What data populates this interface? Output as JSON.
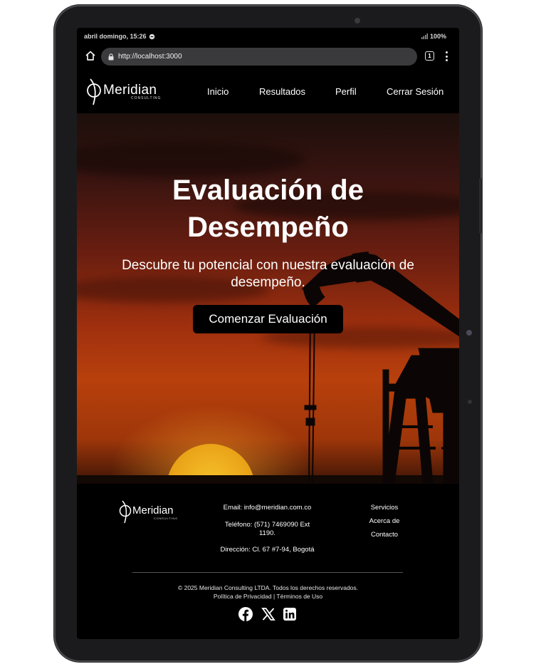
{
  "status_bar": {
    "time_text": "abril domingo, 15:26",
    "battery": "100%"
  },
  "browser": {
    "url": "http://localhost:3000",
    "tab_count": "1"
  },
  "nav": {
    "logo": "Meridian",
    "logo_sub": "CONSULTING",
    "links": [
      "Inicio",
      "Resultados",
      "Perfil",
      "Cerrar Sesión"
    ]
  },
  "hero": {
    "title_line1": "Evaluación de",
    "title_line2": "Desempeño",
    "subtitle": "Descubre tu potencial con nuestra evaluación de desempeño.",
    "cta": "Comenzar Evaluación"
  },
  "footer": {
    "logo": "Meridian",
    "logo_sub": "CONSULTING",
    "email": "Email: info@meridian.com.co",
    "phone": "Teléfono: (571) 7469090 Ext 1190.",
    "address": "Dirección: Cl. 67 #7-94, Bogotá",
    "links": [
      "Servicios",
      "Acerca de",
      "Contacto"
    ],
    "copyright": "© 2025 Meridian Consulting LTDA. Todos los derechos reservados.",
    "privacy": "Política de Privacidad",
    "separator": "|",
    "terms": "Términos de Uso",
    "social": [
      "facebook-icon",
      "x-icon",
      "linkedin-icon"
    ]
  },
  "colors": {
    "background": "#000000",
    "text": "#ffffff",
    "hero_sky": "#a0300e",
    "sun": "#eaa318"
  }
}
